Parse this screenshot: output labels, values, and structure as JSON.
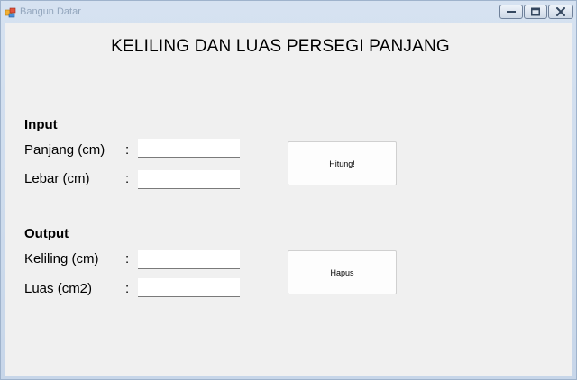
{
  "window": {
    "title": "Bangun Datar",
    "icon": "windows-forms-app-icon",
    "controls": [
      "minimize-icon",
      "maximize-icon",
      "close-icon"
    ]
  },
  "form": {
    "heading": "KELILING DAN LUAS PERSEGI PANJANG",
    "input_section": {
      "title": "Input",
      "fields": [
        {
          "label": "Panjang (cm)",
          "colon": ":",
          "value": ""
        },
        {
          "label": "Lebar (cm)",
          "colon": ":",
          "value": ""
        }
      ]
    },
    "output_section": {
      "title": "Output",
      "fields": [
        {
          "label": "Keliling (cm)",
          "colon": ":",
          "value": ""
        },
        {
          "label": "Luas (cm2)",
          "colon": ":",
          "value": ""
        }
      ]
    },
    "buttons": {
      "calculate_label": "Hitung!",
      "clear_label": "Hapus"
    }
  }
}
